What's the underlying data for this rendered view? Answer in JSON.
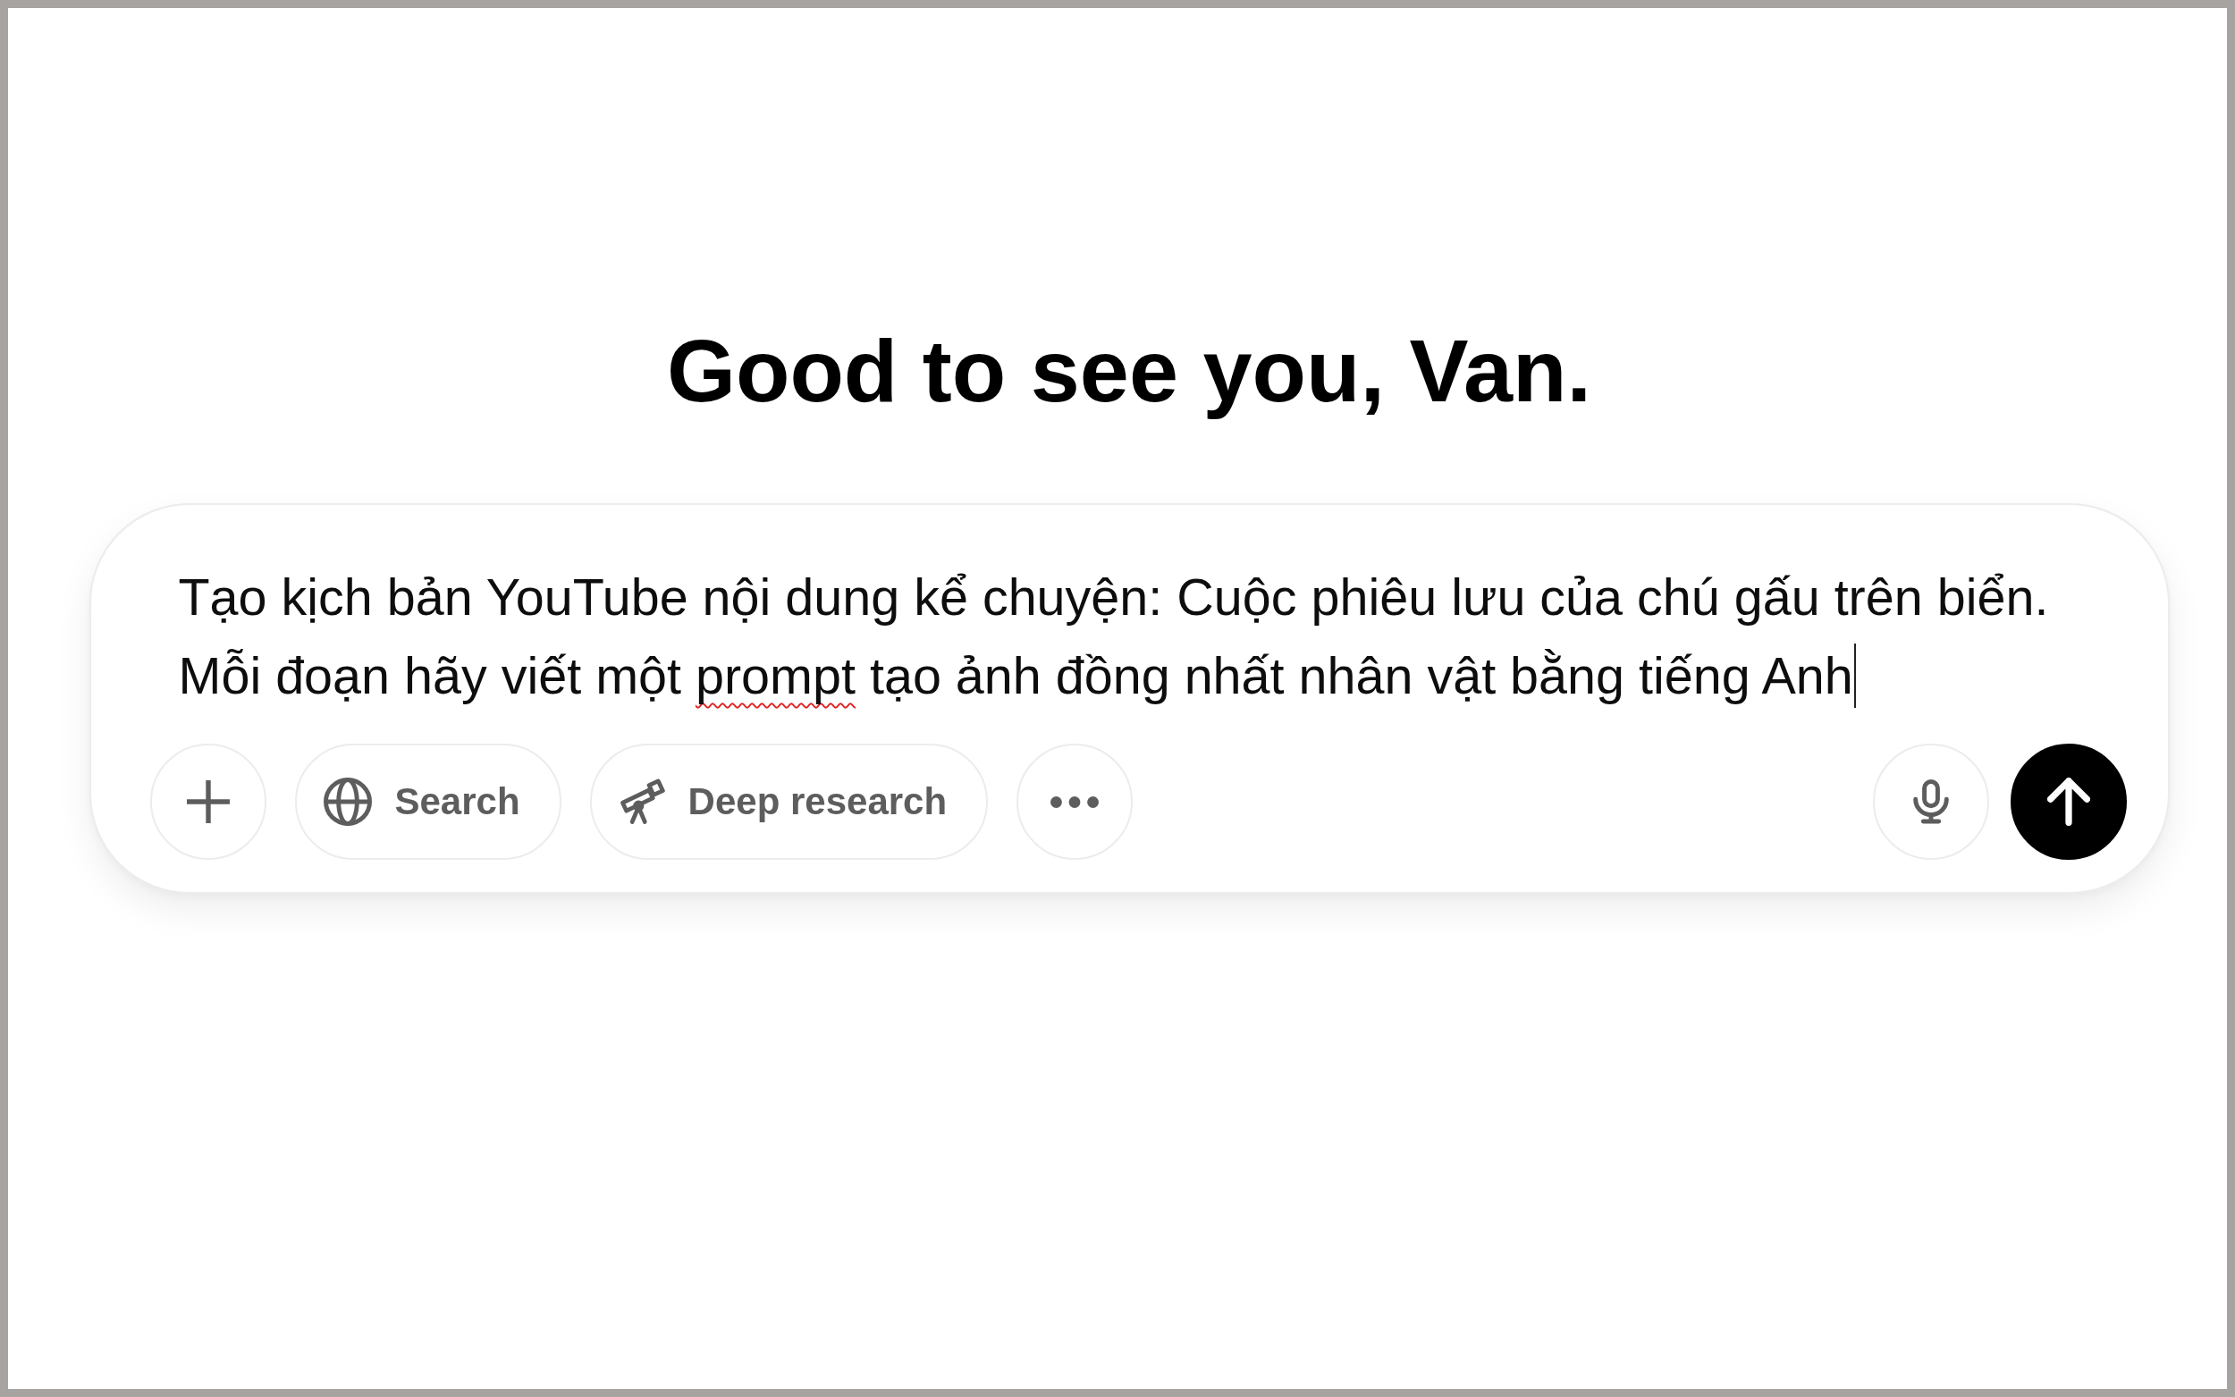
{
  "greeting": "Good to see you, Van.",
  "composer": {
    "input": {
      "segments": [
        {
          "text": "Tạo kịch bản YouTube nội dung kể chuyện: Cuộc phiêu lưu của chú gấu trên biển. Mỗi đoạn hãy viết một ",
          "misspelled": false
        },
        {
          "text": "prompt",
          "misspelled": true
        },
        {
          "text": " tạo ảnh đồng nhất nhân vật bằng tiếng Anh",
          "misspelled": false
        }
      ],
      "focused": true
    },
    "tools": [
      {
        "kind": "add"
      },
      {
        "kind": "search",
        "label": "Search"
      },
      {
        "kind": "deep_research",
        "label": "Deep research"
      },
      {
        "kind": "more"
      }
    ],
    "actions": [
      {
        "kind": "voice"
      },
      {
        "kind": "send"
      }
    ]
  }
}
